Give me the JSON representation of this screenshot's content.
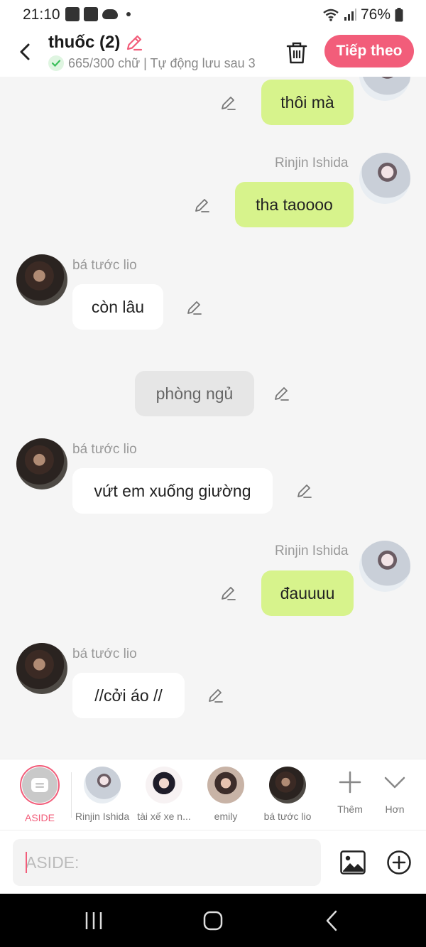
{
  "status_bar": {
    "time": "21:10",
    "battery": "76%",
    "icons": [
      "gallery-icon",
      "media-icon",
      "cloud-icon",
      "dot-icon",
      "wifi-icon",
      "signal-icon",
      "battery-icon"
    ]
  },
  "header": {
    "title": "thuốc (2)",
    "subtitle": "665/300 chữ | Tự động lưu sau 3",
    "next_label": "Tiếp theo",
    "accent_color": "#f25d7a"
  },
  "messages": [
    {
      "sender": "Rinjin Ishida",
      "side": "right",
      "text": "thôi mà"
    },
    {
      "sender": "Rinjin Ishida",
      "side": "right",
      "text": "tha taoooo"
    },
    {
      "sender": "bá tước lio",
      "side": "left",
      "text": "còn lâu"
    },
    {
      "sender": "",
      "side": "center",
      "text": "phòng ngủ"
    },
    {
      "sender": "bá tước lio",
      "side": "left",
      "text": "vứt em xuống giường"
    },
    {
      "sender": "Rinjin Ishida",
      "side": "right",
      "text": "đauuuu"
    },
    {
      "sender": "bá tước lio",
      "side": "left",
      "text": "//cởi áo //"
    }
  ],
  "characters": [
    {
      "label": "ASIDE",
      "selected": true
    },
    {
      "label": "Rinjin Ishida",
      "selected": false
    },
    {
      "label": "tài xế xe n...",
      "selected": false
    },
    {
      "label": "emily",
      "selected": false
    },
    {
      "label": "bá tước lio",
      "selected": false
    }
  ],
  "tools": {
    "add_label": "Thêm",
    "more_label": "Hơn"
  },
  "input": {
    "placeholder": "ASIDE:",
    "value": ""
  },
  "colors": {
    "my_bubble": "#d7f38c",
    "their_bubble": "#ffffff",
    "aside_bubble": "#e6e6e6",
    "background": "#f5f5f5"
  }
}
